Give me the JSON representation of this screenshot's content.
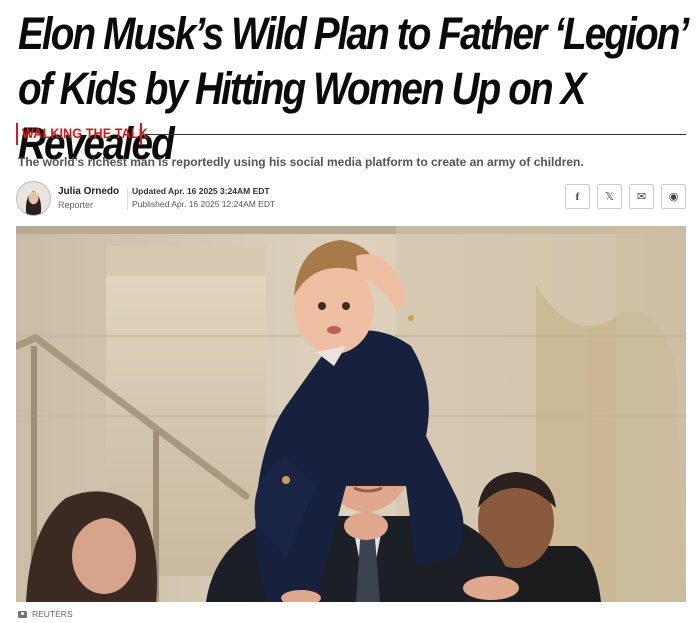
{
  "article": {
    "headline": "Elon Musk’s Wild Plan to Father ‘Legion’ of Kids by Hitting Women Up on X Revealed",
    "kicker": "WALKING THE TALK",
    "dek": "The world’s richest man is reportedly using his social media platform to create an army of children."
  },
  "byline": {
    "author": "Julia Ornedo",
    "role": "Reporter",
    "updated": "Updated Apr. 16 2025 3:24AM EDT",
    "published": "Published Apr. 16 2025 12:24AM EDT"
  },
  "share": {
    "facebook": "f",
    "x": "𝕏",
    "email": "✉",
    "reddit": "◉"
  },
  "photo": {
    "credit": "REUTERS"
  },
  "colors": {
    "accent": "#e0161f",
    "suit": "#17213d"
  }
}
